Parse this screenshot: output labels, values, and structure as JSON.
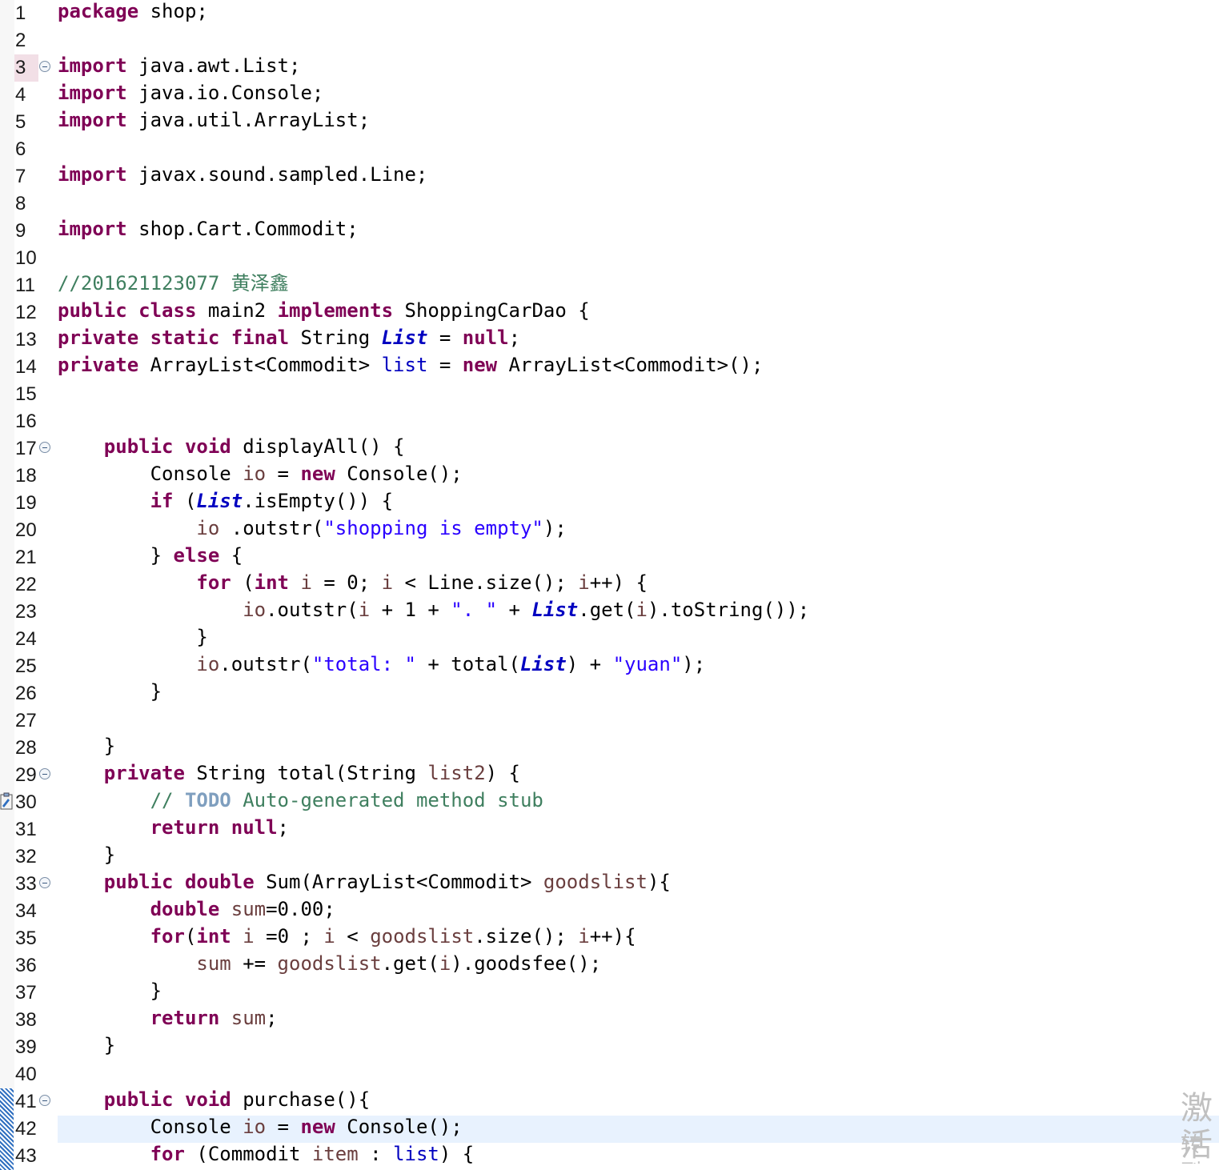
{
  "editor": {
    "line_numbers": [
      "1",
      "2",
      "3",
      "4",
      "5",
      "6",
      "7",
      "8",
      "9",
      "10",
      "11",
      "12",
      "13",
      "14",
      "15",
      "16",
      "17",
      "18",
      "19",
      "20",
      "21",
      "22",
      "23",
      "24",
      "25",
      "26",
      "27",
      "28",
      "29",
      "30",
      "31",
      "32",
      "33",
      "34",
      "35",
      "36",
      "37",
      "38",
      "39",
      "40",
      "41",
      "42",
      "43"
    ],
    "current_line": "42",
    "fold_lines": [
      "3",
      "17",
      "29",
      "33",
      "41"
    ],
    "lines": [
      [
        {
          "t": "kw",
          "v": "package"
        },
        {
          "v": " shop;"
        }
      ],
      [],
      [
        {
          "t": "kw",
          "v": "import"
        },
        {
          "v": " java.awt.List;"
        }
      ],
      [
        {
          "t": "kw",
          "v": "import"
        },
        {
          "v": " java.io.Console;"
        }
      ],
      [
        {
          "t": "kw",
          "v": "import"
        },
        {
          "v": " java.util.ArrayList;"
        }
      ],
      [],
      [
        {
          "t": "kw",
          "v": "import"
        },
        {
          "v": " javax.sound.sampled.Line;"
        }
      ],
      [],
      [
        {
          "t": "kw",
          "v": "import"
        },
        {
          "v": " shop.Cart.Commodit;"
        }
      ],
      [],
      [
        {
          "t": "cm",
          "v": "//201621123077 黄泽鑫"
        }
      ],
      [
        {
          "t": "kw",
          "v": "public"
        },
        {
          "v": " "
        },
        {
          "t": "kw",
          "v": "class"
        },
        {
          "v": " main2 "
        },
        {
          "t": "kw",
          "v": "implements"
        },
        {
          "v": " ShoppingCarDao {"
        }
      ],
      [
        {
          "t": "kw",
          "v": "private"
        },
        {
          "v": " "
        },
        {
          "t": "kw",
          "v": "static"
        },
        {
          "v": " "
        },
        {
          "t": "kw",
          "v": "final"
        },
        {
          "v": " String "
        },
        {
          "t": "sf",
          "v": "List"
        },
        {
          "v": " = "
        },
        {
          "t": "kw",
          "v": "null"
        },
        {
          "v": ";"
        }
      ],
      [
        {
          "t": "kw",
          "v": "private"
        },
        {
          "v": " ArrayList<Commodit> "
        },
        {
          "t": "fld",
          "v": "list"
        },
        {
          "v": " = "
        },
        {
          "t": "kw",
          "v": "new"
        },
        {
          "v": " ArrayList<Commodit>();"
        }
      ],
      [],
      [],
      [
        {
          "v": "    "
        },
        {
          "t": "kw",
          "v": "public"
        },
        {
          "v": " "
        },
        {
          "t": "kw",
          "v": "void"
        },
        {
          "v": " displayAll() {"
        }
      ],
      [
        {
          "v": "        Console "
        },
        {
          "t": "lv",
          "v": "io"
        },
        {
          "v": " = "
        },
        {
          "t": "kw",
          "v": "new"
        },
        {
          "v": " Console();"
        }
      ],
      [
        {
          "v": "        "
        },
        {
          "t": "kw",
          "v": "if"
        },
        {
          "v": " ("
        },
        {
          "t": "sf",
          "v": "List"
        },
        {
          "v": ".isEmpty()) {"
        }
      ],
      [
        {
          "v": "            "
        },
        {
          "t": "lv",
          "v": "io"
        },
        {
          "v": " .outstr("
        },
        {
          "t": "st",
          "v": "\"shopping is empty\""
        },
        {
          "v": ");"
        }
      ],
      [
        {
          "v": "        } "
        },
        {
          "t": "kw",
          "v": "else"
        },
        {
          "v": " {"
        }
      ],
      [
        {
          "v": "            "
        },
        {
          "t": "kw",
          "v": "for"
        },
        {
          "v": " ("
        },
        {
          "t": "kw",
          "v": "int"
        },
        {
          "v": " "
        },
        {
          "t": "lv",
          "v": "i"
        },
        {
          "v": " = 0; "
        },
        {
          "t": "lv",
          "v": "i"
        },
        {
          "v": " < Line.size(); "
        },
        {
          "t": "lv",
          "v": "i"
        },
        {
          "v": "++) {"
        }
      ],
      [
        {
          "v": "                "
        },
        {
          "t": "lv",
          "v": "io"
        },
        {
          "v": ".outstr("
        },
        {
          "t": "lv",
          "v": "i"
        },
        {
          "v": " + 1 + "
        },
        {
          "t": "st",
          "v": "\". \""
        },
        {
          "v": " + "
        },
        {
          "t": "sf",
          "v": "List"
        },
        {
          "v": ".get("
        },
        {
          "t": "lv",
          "v": "i"
        },
        {
          "v": ").toString());"
        }
      ],
      [
        {
          "v": "            }"
        }
      ],
      [
        {
          "v": "            "
        },
        {
          "t": "lv",
          "v": "io"
        },
        {
          "v": ".outstr("
        },
        {
          "t": "st",
          "v": "\"total: \""
        },
        {
          "v": " + total("
        },
        {
          "t": "sf",
          "v": "List"
        },
        {
          "v": ") + "
        },
        {
          "t": "st",
          "v": "\"yuan\""
        },
        {
          "v": ");"
        }
      ],
      [
        {
          "v": "        }"
        }
      ],
      [],
      [
        {
          "v": "    }"
        }
      ],
      [
        {
          "v": "    "
        },
        {
          "t": "kw",
          "v": "private"
        },
        {
          "v": " String total(String "
        },
        {
          "t": "lv",
          "v": "list2"
        },
        {
          "v": ") {"
        }
      ],
      [
        {
          "v": "        "
        },
        {
          "t": "cm",
          "v": "// "
        },
        {
          "t": "todo",
          "v": "TODO"
        },
        {
          "t": "cm",
          "v": " Auto-generated method stub"
        }
      ],
      [
        {
          "v": "        "
        },
        {
          "t": "kw",
          "v": "return"
        },
        {
          "v": " "
        },
        {
          "t": "kw",
          "v": "null"
        },
        {
          "v": ";"
        }
      ],
      [
        {
          "v": "    }"
        }
      ],
      [
        {
          "v": "    "
        },
        {
          "t": "kw",
          "v": "public"
        },
        {
          "v": " "
        },
        {
          "t": "kw",
          "v": "double"
        },
        {
          "v": " Sum(ArrayList<Commodit> "
        },
        {
          "t": "lv",
          "v": "goodslist"
        },
        {
          "v": "){"
        }
      ],
      [
        {
          "v": "        "
        },
        {
          "t": "kw",
          "v": "double"
        },
        {
          "v": " "
        },
        {
          "t": "lv",
          "v": "sum"
        },
        {
          "v": "=0.00;"
        }
      ],
      [
        {
          "v": "        "
        },
        {
          "t": "kw",
          "v": "for"
        },
        {
          "v": "("
        },
        {
          "t": "kw",
          "v": "int"
        },
        {
          "v": " "
        },
        {
          "t": "lv",
          "v": "i"
        },
        {
          "v": " =0 ; "
        },
        {
          "t": "lv",
          "v": "i"
        },
        {
          "v": " < "
        },
        {
          "t": "lv",
          "v": "goodslist"
        },
        {
          "v": ".size(); "
        },
        {
          "t": "lv",
          "v": "i"
        },
        {
          "v": "++){"
        }
      ],
      [
        {
          "v": "            "
        },
        {
          "t": "lv",
          "v": "sum"
        },
        {
          "v": " += "
        },
        {
          "t": "lv",
          "v": "goodslist"
        },
        {
          "v": ".get("
        },
        {
          "t": "lv",
          "v": "i"
        },
        {
          "v": ").goodsfee();"
        }
      ],
      [
        {
          "v": "        }"
        }
      ],
      [
        {
          "v": "        "
        },
        {
          "t": "kw",
          "v": "return"
        },
        {
          "v": " "
        },
        {
          "t": "lv",
          "v": "sum"
        },
        {
          "v": ";"
        }
      ],
      [
        {
          "v": "    }"
        }
      ],
      [],
      [
        {
          "v": "    "
        },
        {
          "t": "kw",
          "v": "public"
        },
        {
          "v": " "
        },
        {
          "t": "kw",
          "v": "void"
        },
        {
          "v": " purchase(){"
        }
      ],
      [
        {
          "v": "        Console "
        },
        {
          "t": "lv",
          "v": "io"
        },
        {
          "v": " = "
        },
        {
          "t": "kw",
          "v": "new"
        },
        {
          "v": " Console();"
        }
      ],
      [
        {
          "v": "        "
        },
        {
          "t": "kw",
          "v": "for"
        },
        {
          "v": " (Commodit "
        },
        {
          "t": "lv",
          "v": "item"
        },
        {
          "v": " : "
        },
        {
          "t": "fld",
          "v": "list"
        },
        {
          "v": ") {"
        }
      ]
    ]
  },
  "watermark": {
    "line1": "激活",
    "line2": "转到"
  },
  "colors": {
    "keyword": "#7f0055",
    "comment": "#3f7f5f",
    "string": "#2a00ff",
    "field": "#0000c0",
    "local_variable": "#6a3e3e",
    "current_line_bg": "#e8f2fe"
  }
}
